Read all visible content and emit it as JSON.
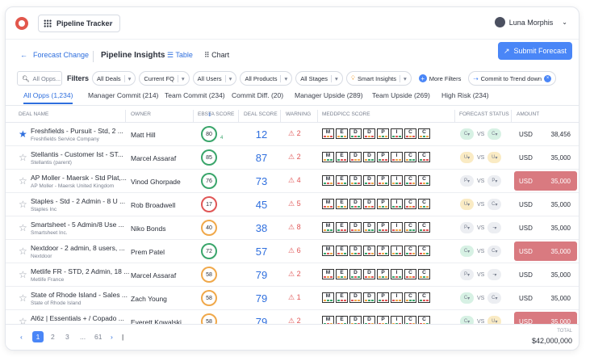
{
  "app": {
    "selector_label": "Pipeline Tracker",
    "user_name": "Luna Morphis"
  },
  "header": {
    "back_label": "Forecast Change",
    "title": "Pipeline Insights",
    "view_table": "Table",
    "view_chart": "Chart",
    "submit_label": "Submit Forecast"
  },
  "filters": {
    "search_placeholder": "All Opps...",
    "label": "Filters",
    "chips": [
      "All Deals",
      "Current FQ",
      "All Users",
      "All Products",
      "All Stages",
      "Smart Insights"
    ],
    "more_label": "More Filters",
    "trend_label": "Commit to Trend down"
  },
  "tabs": [
    "All Opps (1,234)",
    "Manager Commit (214)",
    "Team Commit (234)",
    "Commit Diff. (20)",
    "Manager Upside (289)",
    "Team Upside (269)",
    "High Risk (234)"
  ],
  "columns": {
    "deal_name": "DEAL NAME",
    "owner": "OWNER",
    "ebsta": "EBSTA SCORE",
    "deal_score": "DEAL SCORE",
    "warning": "WARNING",
    "meddpicc": "MEDDPICC SCORE",
    "forecast_status": "FORECAST STATUS",
    "amount": "AMOUNT"
  },
  "meddpicc_letters": [
    "M",
    "E",
    "D",
    "D",
    "P",
    "I",
    "C",
    "C"
  ],
  "vs_label": "VS",
  "rows": [
    {
      "starred": true,
      "name": "Freshfields - Pursuit - Std, 2 ...",
      "sub": "Freshfields Service Company",
      "owner": "Matt Hill",
      "ebsta": "80",
      "ebsta_color": "#3aa56b",
      "ebsta_delta": "4",
      "score": "12",
      "warning": "2",
      "status_a": "C",
      "status_a_color": "#d7f1e4",
      "status_b": "C",
      "status_b_color": "#d7f1e4",
      "currency": "USD",
      "amount": "38,456",
      "highlight": false
    },
    {
      "starred": false,
      "name": "Stellantis - Customer Ist - ST...",
      "sub": "Stellantis (parent)",
      "owner": "Marcel Assaraf",
      "ebsta": "85",
      "ebsta_color": "#3aa56b",
      "ebsta_delta": "",
      "score": "87",
      "warning": "2",
      "status_a": "U",
      "status_a_color": "#faebc4",
      "status_b": "U",
      "status_b_color": "#faebc4",
      "currency": "USD",
      "amount": "35,000",
      "highlight": false
    },
    {
      "starred": false,
      "name": "AP Moller - Maersk - Std Plat,...",
      "sub": "AP Moller - Maersk United Kingdom",
      "owner": "Vinod Ghorpade",
      "ebsta": "76",
      "ebsta_color": "#3aa56b",
      "ebsta_delta": "",
      "score": "73",
      "warning": "4",
      "status_a": "P",
      "status_a_color": "#eceef2",
      "status_b": "P",
      "status_b_color": "#eceef2",
      "currency": "USD",
      "amount": "35,000",
      "highlight": true
    },
    {
      "starred": false,
      "name": "Staples - Std - 2 Admin - 8 U ...",
      "sub": "Staples Inc",
      "owner": "Rob Broadwell",
      "ebsta": "17",
      "ebsta_color": "#e05656",
      "ebsta_delta": "",
      "score": "45",
      "warning": "5",
      "status_a": "U",
      "status_a_color": "#faebc4",
      "status_b": "C",
      "status_b_color": "#eceef2",
      "currency": "USD",
      "amount": "35,000",
      "highlight": false
    },
    {
      "starred": false,
      "name": "Smartsheet - 5 Admin/8 Use ...",
      "sub": "Smartsheet Inc.",
      "owner": "Niko Bonds",
      "ebsta": "40",
      "ebsta_color": "#f0a84a",
      "ebsta_delta": "",
      "score": "38",
      "warning": "8",
      "status_a": "P",
      "status_a_color": "#eceef2",
      "status_b": "-",
      "status_b_color": "#eceef2",
      "currency": "USD",
      "amount": "35,000",
      "highlight": false
    },
    {
      "starred": false,
      "name": "Nextdoor - 2 admin, 8 users, ...",
      "sub": "Nextdoor",
      "owner": "Prem Patel",
      "ebsta": "72",
      "ebsta_color": "#3aa56b",
      "ebsta_delta": "",
      "score": "57",
      "warning": "6",
      "status_a": "C",
      "status_a_color": "#d7f1e4",
      "status_b": "C",
      "status_b_color": "#eceef2",
      "currency": "USD",
      "amount": "35,000",
      "highlight": true
    },
    {
      "starred": false,
      "name": "Metlife FR - STD, 2 Admin, 18 ...",
      "sub": "Metlife France",
      "owner": "Marcel Assaraf",
      "ebsta": "58",
      "ebsta_color": "#f0a84a",
      "ebsta_delta": "",
      "score": "79",
      "warning": "2",
      "status_a": "P",
      "status_a_color": "#eceef2",
      "status_b": "-",
      "status_b_color": "#eceef2",
      "currency": "USD",
      "amount": "35,000",
      "highlight": false
    },
    {
      "starred": false,
      "name": "State of Rhode Island - Sales ...",
      "sub": "State of Rhode Island",
      "owner": "Zach Young",
      "ebsta": "58",
      "ebsta_color": "#f0a84a",
      "ebsta_delta": "",
      "score": "79",
      "warning": "1",
      "status_a": "C",
      "status_a_color": "#d7f1e4",
      "status_b": "C",
      "status_b_color": "#eceef2",
      "currency": "USD",
      "amount": "35,000",
      "highlight": false
    },
    {
      "starred": false,
      "name": "Al6z | Essentials + / Copado ...",
      "sub": "",
      "owner": "Everett Kowalski",
      "ebsta": "58",
      "ebsta_color": "#f0a84a",
      "ebsta_delta": "",
      "score": "79",
      "warning": "2",
      "status_a": "C",
      "status_a_color": "#d7f1e4",
      "status_b": "U",
      "status_b_color": "#faebc4",
      "currency": "USD",
      "amount": "35,000",
      "highlight": true
    }
  ],
  "pager": {
    "pages": [
      "1",
      "2",
      "3",
      "...",
      "61"
    ],
    "total_label": "TOTAL",
    "total_value": "$42,000,000"
  },
  "colors": {
    "accent": "#4a86f7",
    "highlight": "#d97a80",
    "danger": "#e05656"
  }
}
